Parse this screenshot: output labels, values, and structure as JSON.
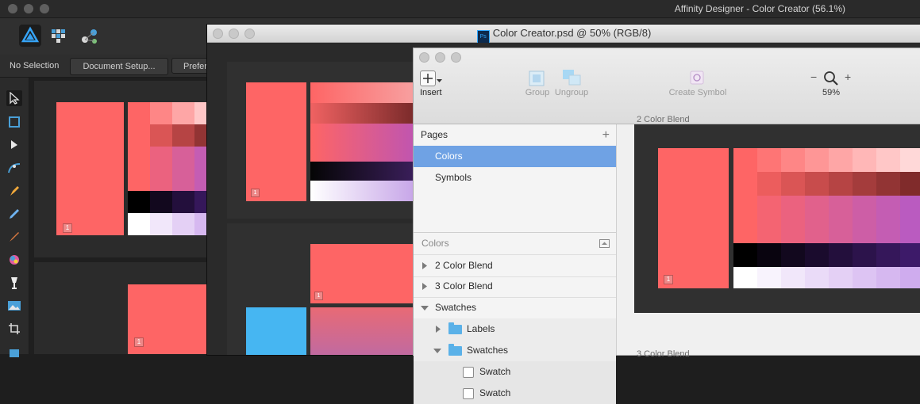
{
  "affinity": {
    "window_title": "Affinity Designer - Color Creator (56.1%)",
    "context_no_selection": "No Selection",
    "context_document_setup": "Document Setup...",
    "context_preferences": "Prefer",
    "artboard_badge": "1"
  },
  "photoshop": {
    "window_title": "Color Creator.psd @ 50% (RGB/8)",
    "ps_badge": "Ps",
    "artboard_badge": "1"
  },
  "sketch": {
    "toolbar": {
      "insert": "Insert",
      "group": "Group",
      "ungroup": "Ungroup",
      "create_symbol": "Create Symbol",
      "zoom_minus": "−",
      "zoom_plus": "+",
      "zoom_level": "59%"
    },
    "pages_header": "Pages",
    "pages_add": "+",
    "pages": [
      "Colors",
      "Symbols"
    ],
    "layers_header": "Colors",
    "layers": {
      "two_color_blend": "2 Color Blend",
      "three_color_blend": "3 Color Blend",
      "swatches": "Swatches",
      "labels": "Labels",
      "swatches_folder": "Swatches",
      "swatch_1": "Swatch",
      "swatch_2": "Swatch"
    },
    "canvas_artboard_1": "2 Color Blend",
    "canvas_artboard_2": "3 Color Blend",
    "artboard_badge": "1"
  },
  "colors": {
    "coral": "#fe6565",
    "blue": "#46b6f2",
    "selected_page": "#6fa2e4"
  }
}
